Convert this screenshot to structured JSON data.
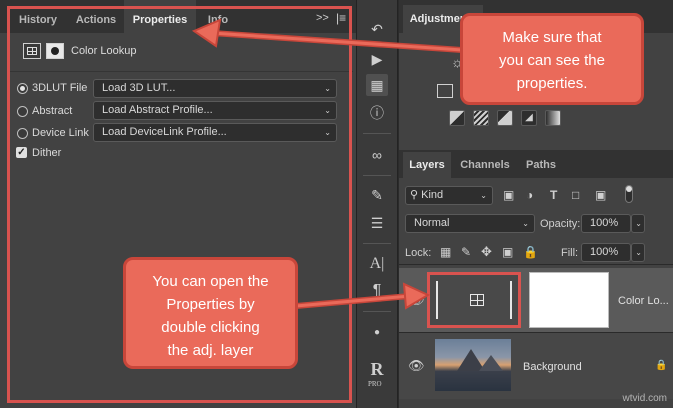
{
  "left_panel": {
    "tabs": [
      {
        "label": "History",
        "active": false
      },
      {
        "label": "Actions",
        "active": false
      },
      {
        "label": "Properties",
        "active": true
      },
      {
        "label": "Info",
        "active": false
      }
    ],
    "header": {
      "title": "Color Lookup"
    },
    "options": [
      {
        "label": "3DLUT File",
        "value": "Load 3D LUT...",
        "selected": true
      },
      {
        "label": "Abstract",
        "value": "Load Abstract Profile...",
        "selected": false
      },
      {
        "label": "Device Link",
        "value": "Load DeviceLink Profile...",
        "selected": false
      }
    ],
    "dither": {
      "label": "Dither",
      "checked": true
    }
  },
  "toolbar": {
    "icons": [
      "history-brush-icon",
      "play-icon",
      "properties-icon",
      "info-icon",
      "creative-cloud-icon",
      "brush-settings-icon",
      "adjustments-sliders-icon",
      "character-icon",
      "paragraph-icon",
      "dot-icon",
      "camera-raw-icon"
    ],
    "char_glyph": "A|",
    "para_glyph": "¶",
    "raw_glyph": "R",
    "raw_label": "PRO"
  },
  "adjustments": {
    "title": "Adjustments"
  },
  "layers_panel": {
    "tabs": [
      {
        "label": "Layers",
        "active": true
      },
      {
        "label": "Channels",
        "active": false
      },
      {
        "label": "Paths",
        "active": false
      }
    ],
    "filter_kind": "Kind",
    "blend_mode": "Normal",
    "opacity_label": "Opacity:",
    "opacity_value": "100%",
    "lock_label": "Lock:",
    "fill_label": "Fill:",
    "fill_value": "100%",
    "layers": [
      {
        "name": "Color Lo...",
        "type": "adjustment",
        "selected": true
      },
      {
        "name": "Background",
        "type": "image",
        "selected": false,
        "locked": true
      }
    ]
  },
  "callouts": {
    "top": "Make sure that\nyou can see the\nproperties.",
    "bottom": "You can open the\nProperties by\ndouble clicking\nthe adj. layer"
  },
  "watermark": "wtvid.com",
  "colors": {
    "callout_fill": "#ea6a5a",
    "callout_border": "#c8463a",
    "highlight_border": "#d9534f"
  }
}
